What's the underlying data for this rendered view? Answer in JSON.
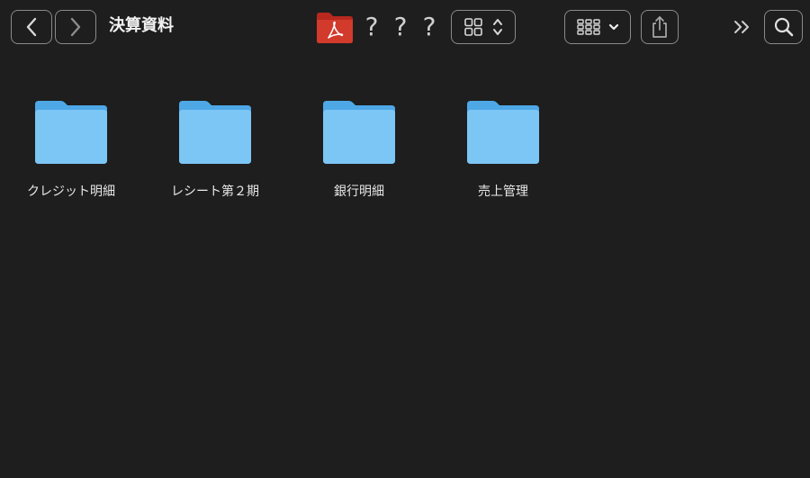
{
  "window": {
    "title": "決算資料"
  },
  "toolbar": {
    "back_icon": "chevron-left-icon",
    "forward_icon": "chevron-right-icon",
    "app_icon": "adobe-acrobat-folder-icon",
    "status_marks": [
      "?",
      "?",
      "?"
    ],
    "view_mode_icon": "grid-view-icon",
    "group_icon": "group-by-icon",
    "share_icon": "share-icon",
    "more_icon": "double-chevron-right-icon",
    "search_icon": "search-icon"
  },
  "colors": {
    "background": "#1e1e1e",
    "folder_light": "#7cc6f6",
    "folder_dark": "#4ea8e6",
    "pdf_red": "#c0392b"
  },
  "items": [
    {
      "label": "クレジット明細",
      "icon": "folder-icon"
    },
    {
      "label": "レシート第２期",
      "icon": "folder-icon"
    },
    {
      "label": "銀行明細",
      "icon": "folder-icon"
    },
    {
      "label": "売上管理",
      "icon": "folder-icon"
    }
  ]
}
